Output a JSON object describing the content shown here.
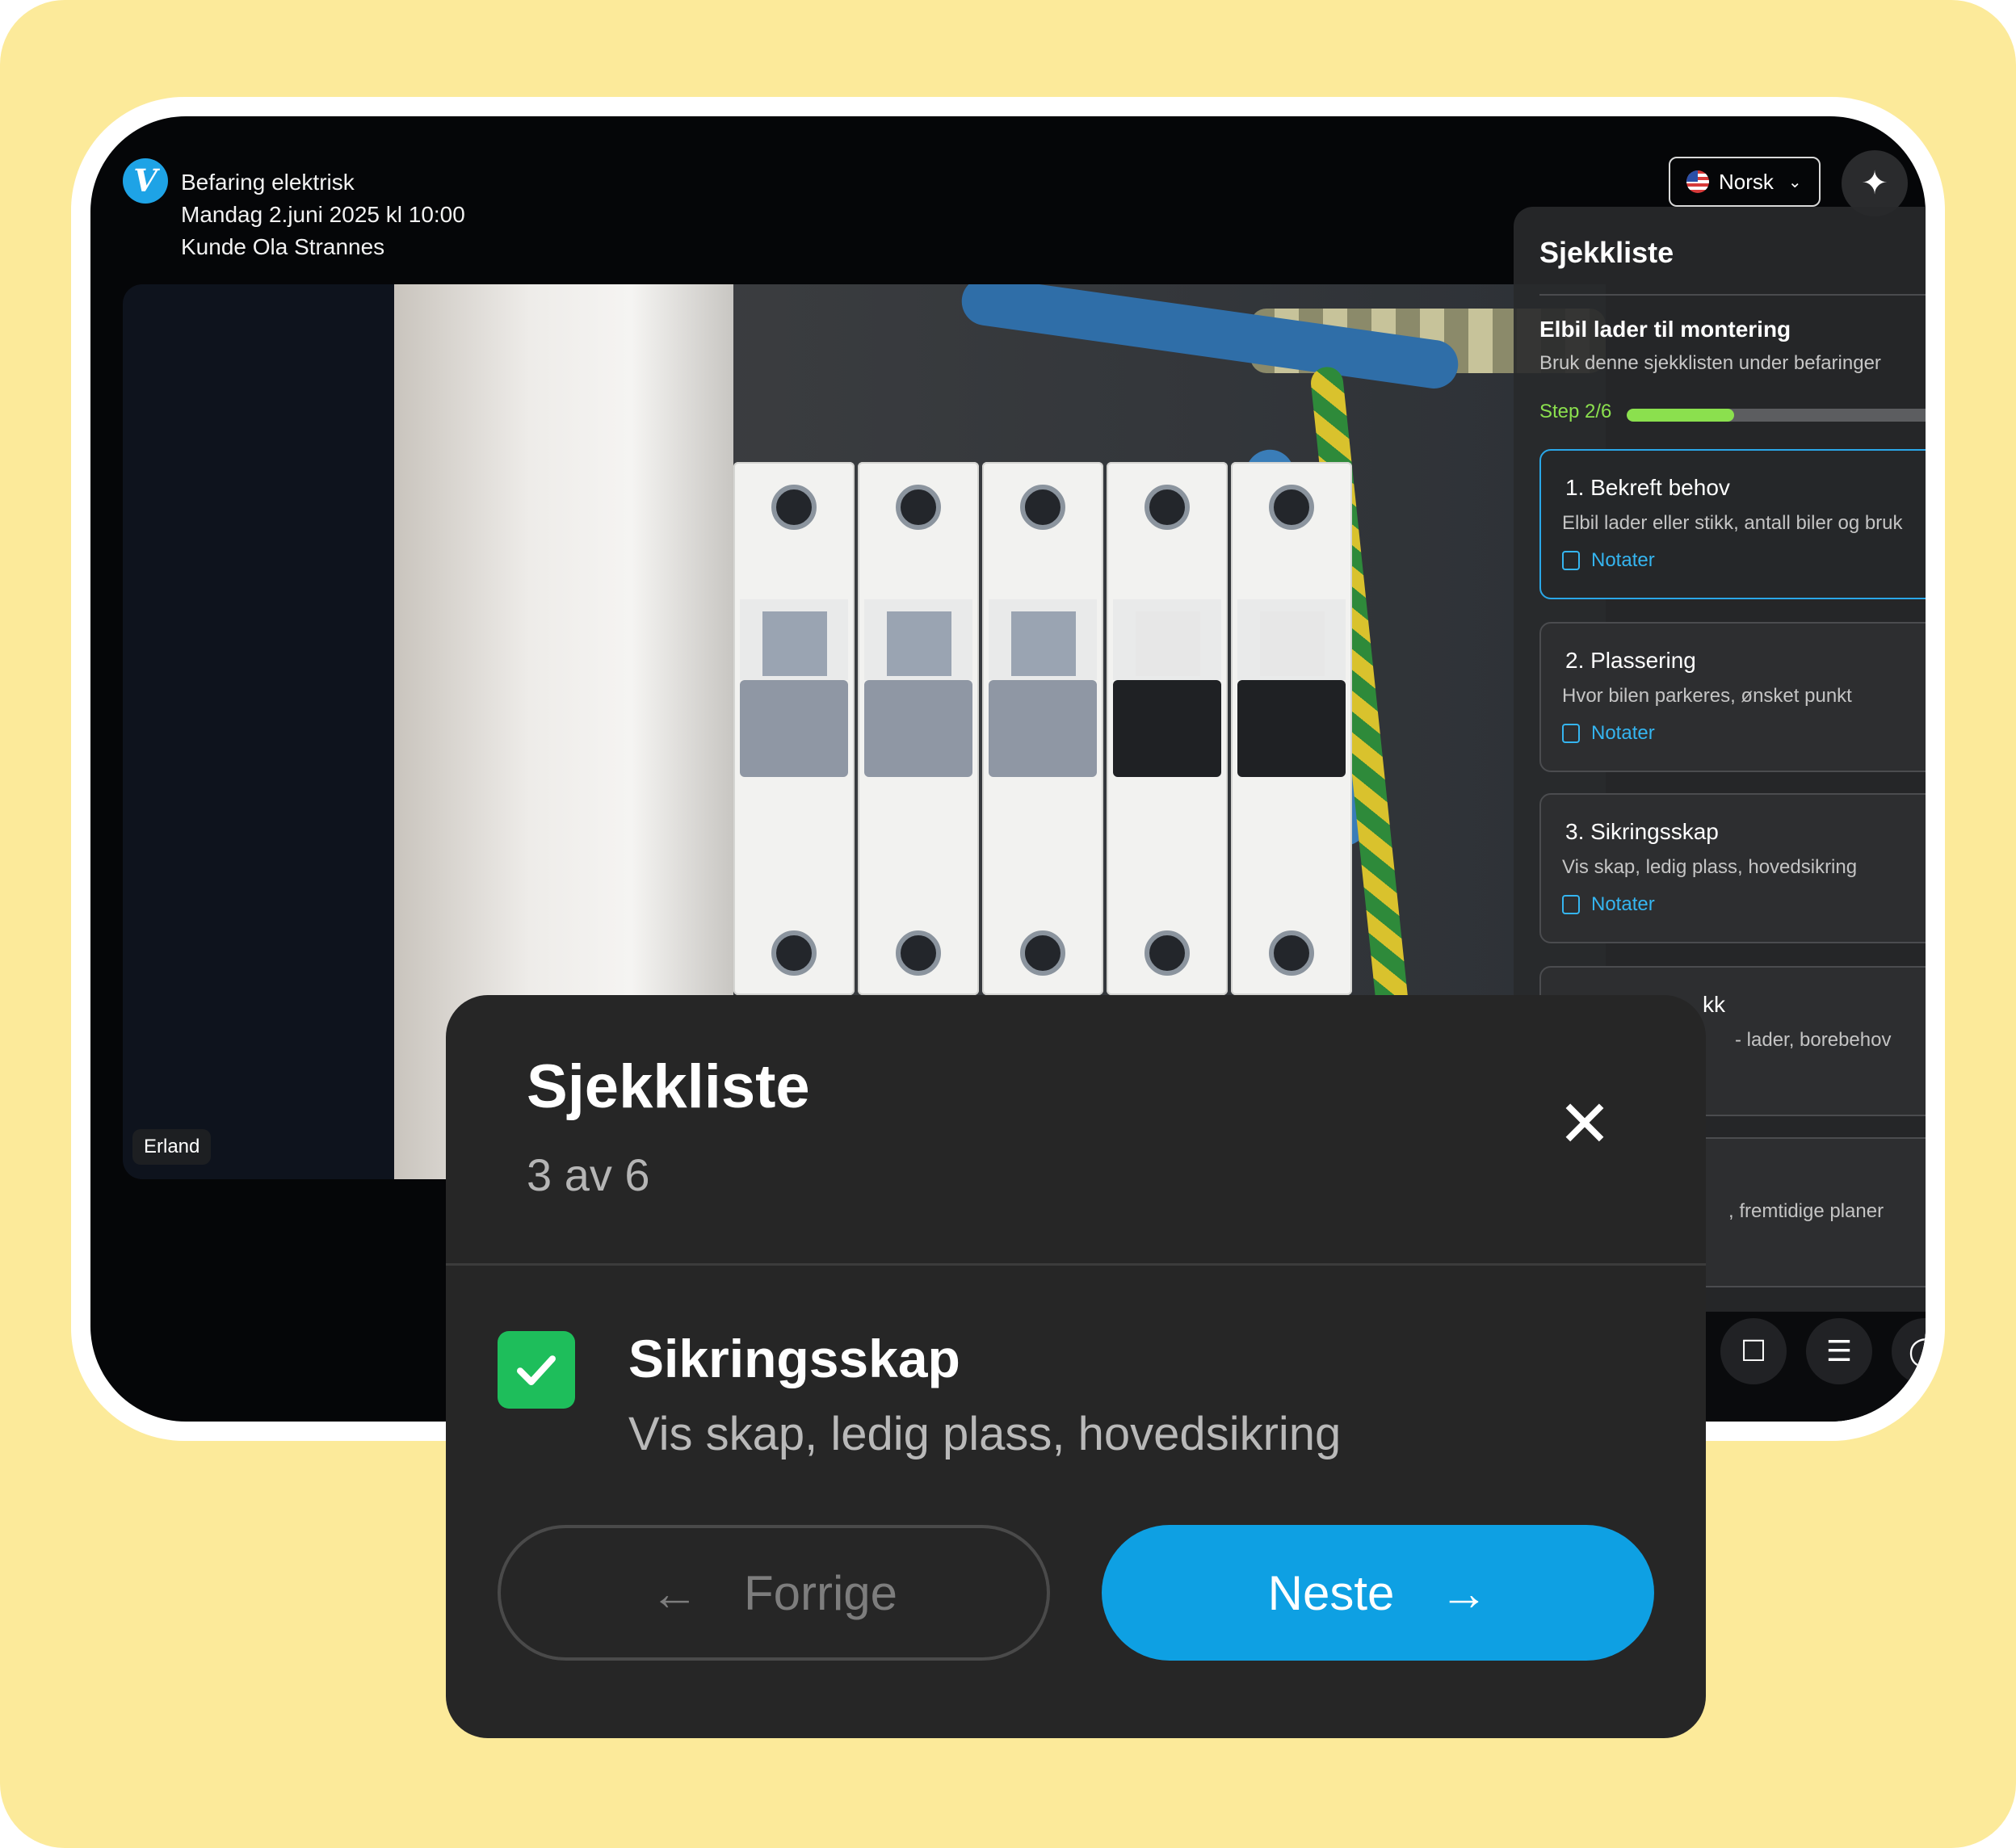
{
  "call": {
    "title": "Befaring elektrisk",
    "date": "Mandag 2.juni 2025 kl 10:00",
    "customer": "Kunde Ola Strannes",
    "logo_letter": "V",
    "participant": "Erland"
  },
  "toolbar": {
    "language": "Norsk",
    "language_chevron": "⌄",
    "ai_icon": "✦"
  },
  "panel": {
    "title": "Sjekkliste",
    "checklist_name": "Elbil lader til montering",
    "checklist_desc": "Bruk denne sjekklisten under befaringer",
    "step_label": "Step 2/6",
    "progress_fraction": 0.3333,
    "items": [
      {
        "title": "1. Bekreft behov",
        "desc": "Elbil lader eller stikk, antall biler og bruk",
        "note": "Notater"
      },
      {
        "title": "2. Plassering",
        "desc": "Hvor bilen parkeres, ønsket punkt",
        "note": "Notater"
      },
      {
        "title": "3. Sikringsskap",
        "desc": "Vis skap, ledig plass, hovedsikring",
        "note": "Notater"
      },
      {
        "title": "kk",
        "desc": "- lader, borebehov"
      },
      {
        "title": "",
        "desc": ", fremtidige planer"
      }
    ]
  },
  "modal": {
    "title": "Sjekkliste",
    "count": "3 av 6",
    "close_glyph": "✕",
    "item_title": "Sikringsskap",
    "item_desc": "Vis skap, ledig plass, hovedsikring",
    "prev_label": "Forrige",
    "next_label": "Neste",
    "prev_arrow": "←",
    "next_arrow": "→"
  },
  "colors": {
    "background": "#fcea9a",
    "accent": "#0ea0e3",
    "progress": "#8be04e",
    "check": "#1ebe5b"
  }
}
